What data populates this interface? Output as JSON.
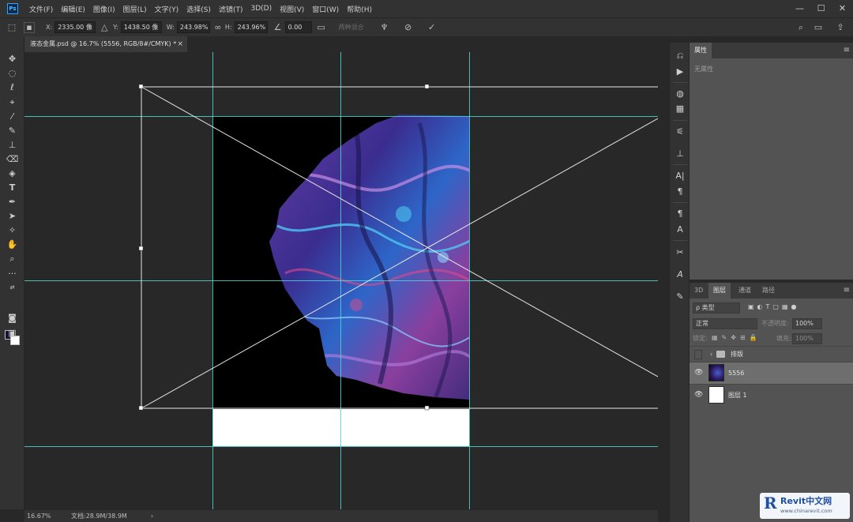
{
  "menubar": {
    "app_icon": "Ps",
    "items": [
      "文件(F)",
      "编辑(E)",
      "图像(I)",
      "图层(L)",
      "文字(Y)",
      "选择(S)",
      "滤镜(T)",
      "3D(D)",
      "视图(V)",
      "窗口(W)",
      "帮助(H)"
    ],
    "window_controls": {
      "minimize": "—",
      "maximize": "☐",
      "close": "✕"
    }
  },
  "options": {
    "x_label": "X:",
    "x_value": "2335.00 像",
    "y_label": "Y:",
    "y_value": "1438.50 像",
    "w_label": "W:",
    "w_value": "243.98%",
    "h_label": "H:",
    "h_value": "243.96%",
    "angle_value": "0.00",
    "interp_label": "插值",
    "warp_label": "两种混合"
  },
  "document_tab": {
    "title": "液态金属.psd @ 16.7% (5556, RGB/8#/CMYK) *",
    "close": "×"
  },
  "status": {
    "zoom": "16.67%",
    "doc_info": "文档:28.9M/38.9M",
    "arrow": "›"
  },
  "panels": {
    "properties": {
      "tab": "属性",
      "note": "无属性"
    },
    "layers": {
      "tabs": [
        "3D",
        "图层",
        "通道",
        "路径"
      ],
      "active_tab": "图层",
      "filter_label": "ρ 类型",
      "blend_mode": "正常",
      "opacity_label": "不透明度:",
      "opacity_value": "100%",
      "lock_label": "锁定:",
      "fill_label": "填充:",
      "fill_value": "100%",
      "items": [
        {
          "name": "排版",
          "type": "group",
          "visible": false,
          "selected": false
        },
        {
          "name": "5556",
          "type": "image",
          "visible": true,
          "selected": true
        },
        {
          "name": "图层 1",
          "type": "fill",
          "visible": true,
          "selected": false
        }
      ]
    }
  },
  "watermark": {
    "logo": "R",
    "title": "Revit中文网",
    "url": "www.chinarevit.com"
  },
  "colors": {
    "guide": "#4fd6d1",
    "foreground_swatch": "#161238",
    "background_swatch": "#ffffff",
    "ui_dark": "#323232",
    "panel": "#535353"
  }
}
